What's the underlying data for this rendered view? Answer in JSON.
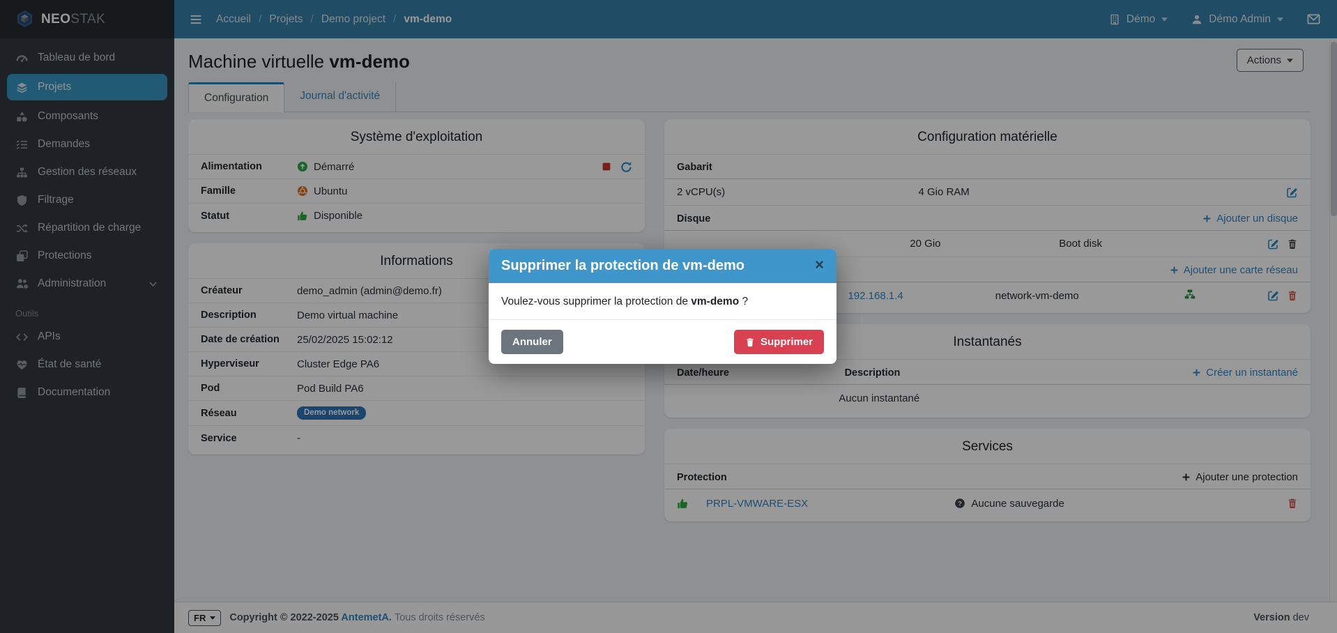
{
  "colors": {
    "navbar": "#367fa9",
    "sidebar": "#32383e",
    "sidebar_active": "#3796c3",
    "content_bg": "#eef1f4",
    "link": "#2f86c4",
    "modal_header": "#3e96ca",
    "danger": "#da4150",
    "success": "#28a745",
    "ubuntu_orange": "#e0711c",
    "badge_blue": "#2d72ba",
    "stop_red": "#c0392b"
  },
  "brand": {
    "logo_icon": "hexagon-cube-icon",
    "name_bold": "NEO",
    "name_light": "STAK"
  },
  "navbar": {
    "menu_icon": "hamburger-icon",
    "separator": "/",
    "breadcrumb": [
      {
        "label": "Accueil"
      },
      {
        "label": "Projets"
      },
      {
        "label": "Demo project"
      },
      {
        "label": "vm-demo"
      }
    ],
    "org": {
      "icon": "building-icon",
      "label": "Démo"
    },
    "user": {
      "icon": "user-icon",
      "label": "Démo Admin"
    },
    "mail_icon": "envelope-icon"
  },
  "sidebar": {
    "items": [
      {
        "icon": "gauge",
        "label": "Tableau de bord"
      },
      {
        "icon": "layers",
        "label": "Projets",
        "active": true
      },
      {
        "icon": "shapes",
        "label": "Composants"
      },
      {
        "icon": "list-check",
        "label": "Demandes"
      },
      {
        "icon": "sitemap",
        "label": "Gestion des réseaux"
      },
      {
        "icon": "shield",
        "label": "Filtrage"
      },
      {
        "icon": "shuffle",
        "label": "Répartition de charge"
      },
      {
        "icon": "clone",
        "label": "Protections"
      },
      {
        "icon": "users-gear",
        "label": "Administration",
        "expandable": true
      }
    ],
    "section": "Outils",
    "tools": [
      {
        "icon": "code",
        "label": "APIs"
      },
      {
        "icon": "heart-pulse",
        "label": "État de santé"
      },
      {
        "icon": "book",
        "label": "Documentation"
      }
    ]
  },
  "header": {
    "title": "Machine virtuelle",
    "title_bold": "vm-demo",
    "actions": "Actions"
  },
  "tabs": {
    "configuration": "Configuration",
    "journal": "Journal d'activité"
  },
  "os": {
    "title": "Système d'exploitation",
    "rows": [
      {
        "label": "Alimentation",
        "value": "Démarré",
        "icon": "arrow-circle-up-green"
      },
      {
        "label": "Famille",
        "value": "Ubuntu",
        "icon": "ubuntu-logo"
      },
      {
        "label": "Statut",
        "value": "Disponible",
        "icon": "thumbs-up-green"
      }
    ]
  },
  "info": {
    "title": "Informations",
    "rows": [
      {
        "label": "Créateur",
        "value": "demo_admin (admin@demo.fr)"
      },
      {
        "label": "Description",
        "value": "Demo virtual machine"
      },
      {
        "label": "Date de création",
        "value": "25/02/2025 15:02:12"
      },
      {
        "label": "Hyperviseur",
        "value": "Cluster Edge PA6"
      },
      {
        "label": "Pod",
        "value": "Pod Build PA6"
      },
      {
        "label": "Réseau",
        "badge": "Demo network"
      },
      {
        "label": "Service",
        "value": "-"
      }
    ]
  },
  "hardware": {
    "title": "Configuration matérielle",
    "template_label": "Gabarit",
    "cpu": "2 vCPU(s)",
    "ram": "4 Gio RAM",
    "disk_label": "Disque",
    "add_disk": "Ajouter un disque",
    "disk_size": "20 Gio",
    "disk_name": "Boot disk",
    "add_nic": "Ajouter une carte réseau",
    "nic_ip": "192.168.1.4",
    "nic_name": "network-vm-demo"
  },
  "snapshots": {
    "title": "Instantanés",
    "col_datetime": "Date/heure",
    "col_description": "Description",
    "create": "Créer un instantané",
    "empty": "Aucun instantané"
  },
  "services": {
    "title": "Services",
    "protection_label": "Protection",
    "add": "Ajouter une protection",
    "name": "PRPL-VMWARE-ESX",
    "backup": "Aucune sauvegarde"
  },
  "modal": {
    "title": "Supprimer la protection de vm-demo",
    "close": "×",
    "question": "Voulez-vous supprimer la protection de",
    "question_bold": "vm-demo",
    "question_end": "?",
    "cancel": "Annuler",
    "confirm": "Supprimer"
  },
  "footer": {
    "lang": "FR",
    "copyright": "Copyright © 2022-2025",
    "brand_link": "AntemetA.",
    "rights": "Tous droits réservés",
    "version_label": "Version",
    "version_value": "dev"
  }
}
